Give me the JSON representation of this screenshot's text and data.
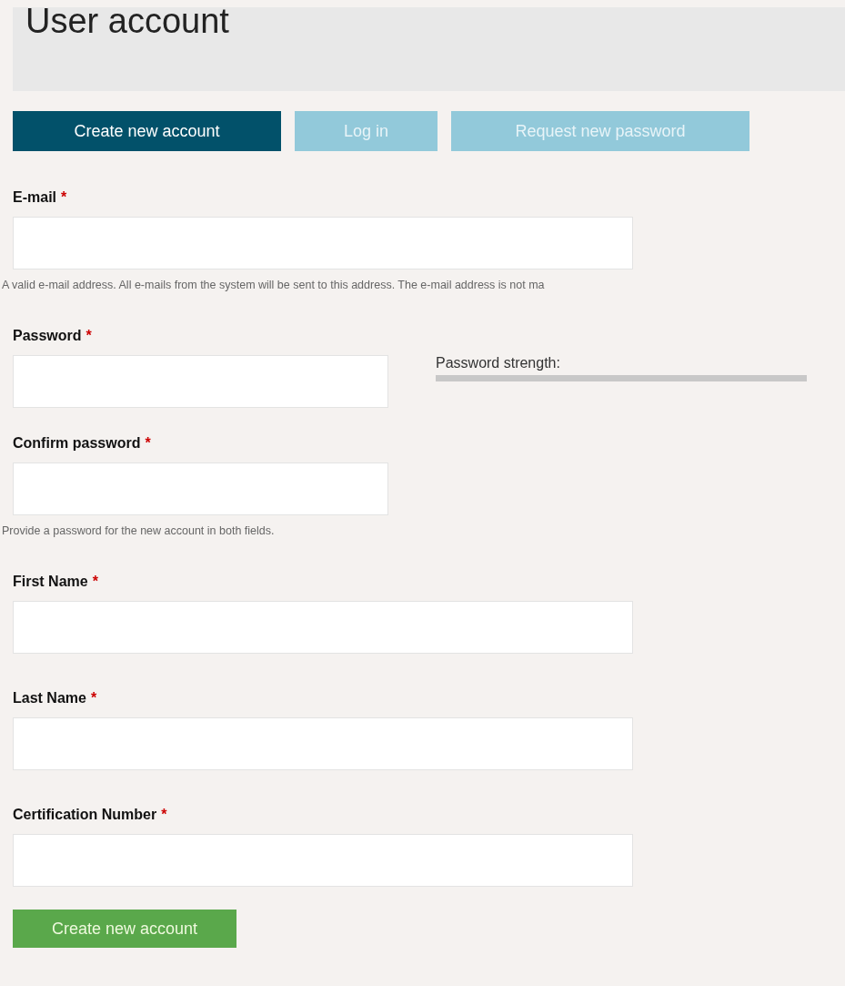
{
  "page_title": "User account",
  "tabs": [
    {
      "label": "Create new account",
      "selected": true
    },
    {
      "label": "Log in",
      "selected": false
    },
    {
      "label": "Request new password",
      "selected": false
    }
  ],
  "fields": [
    {
      "label": "E-mail",
      "required": true,
      "kind": "wide",
      "hint": "A valid e-mail address. All e-mails from the system will be sent to this address. The e-mail address is not ma"
    },
    {
      "label": "Password",
      "required": true,
      "kind": "short",
      "strength_label": "Password strength:"
    },
    {
      "label": "Confirm password",
      "required": true,
      "kind": "short",
      "hint": "Provide a password for the new account in both fields."
    },
    {
      "label": "First Name",
      "required": true,
      "kind": "wide"
    },
    {
      "label": "Last Name",
      "required": true,
      "kind": "wide"
    },
    {
      "label": "Certification Number",
      "required": true,
      "kind": "wide"
    }
  ],
  "required_mark": "*",
  "submit": "Create new account"
}
